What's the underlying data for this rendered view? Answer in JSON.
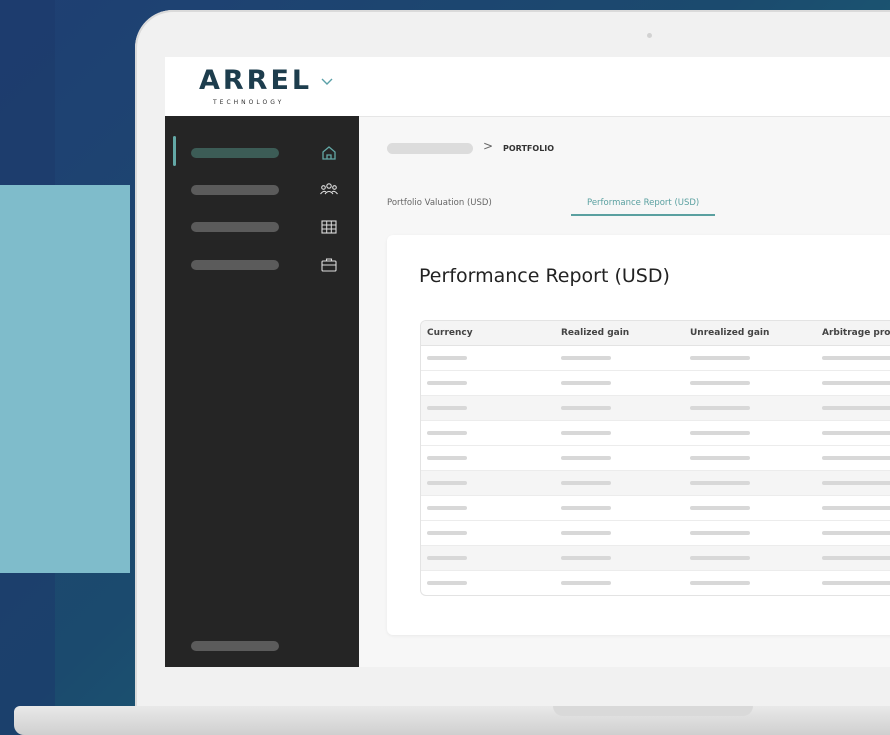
{
  "logo": {
    "word": "ARREL",
    "sub": "TECHNOLOGY"
  },
  "breadcrumb": {
    "separator": ">",
    "current": "PORTFOLIO"
  },
  "tabs": [
    {
      "label": "Portfolio Valuation (USD)",
      "active": false
    },
    {
      "label": "Performance Report (USD)",
      "active": true
    }
  ],
  "card": {
    "title": "Performance Report (USD)"
  },
  "table": {
    "headers": [
      "Currency",
      "Realized gain",
      "Unrealized gain",
      "Arbitrage prof"
    ],
    "row_count": 10,
    "shaded_rows": [
      2,
      5,
      8
    ]
  },
  "sidebar_icons": [
    "home-icon",
    "users-icon",
    "grid-icon",
    "briefcase-icon"
  ],
  "colors": {
    "accent": "#5aa0a0",
    "sidebar": "#252525"
  }
}
